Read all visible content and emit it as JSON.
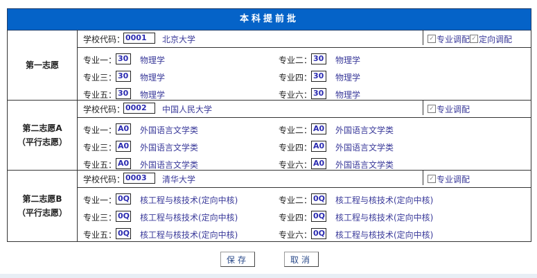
{
  "title": "本科提前批",
  "school_code_label": "学校代码：",
  "sections": [
    {
      "label": "第一志愿",
      "sublabel": "",
      "code": "0001",
      "school": "北京大学",
      "checks": [
        "专业调配",
        "定向调配"
      ],
      "majors": [
        {
          "label": "专业一：",
          "code": "30",
          "name": "物理学"
        },
        {
          "label": "专业二：",
          "code": "30",
          "name": "物理学"
        },
        {
          "label": "专业三：",
          "code": "30",
          "name": "物理学"
        },
        {
          "label": "专业四：",
          "code": "30",
          "name": "物理学"
        },
        {
          "label": "专业五：",
          "code": "30",
          "name": "物理学"
        },
        {
          "label": "专业六：",
          "code": "30",
          "name": "物理学"
        }
      ]
    },
    {
      "label": "第二志愿A",
      "sublabel": "（平行志愿）",
      "code": "0002",
      "school": "中国人民大学",
      "checks": [
        "专业调配"
      ],
      "majors": [
        {
          "label": "专业一：",
          "code": "A0",
          "name": "外国语言文学类"
        },
        {
          "label": "专业二：",
          "code": "A0",
          "name": "外国语言文学类"
        },
        {
          "label": "专业三：",
          "code": "A0",
          "name": "外国语言文学类"
        },
        {
          "label": "专业四：",
          "code": "A0",
          "name": "外国语言文学类"
        },
        {
          "label": "专业五：",
          "code": "A0",
          "name": "外国语言文学类"
        },
        {
          "label": "专业六：",
          "code": "A0",
          "name": "外国语言文学类"
        }
      ]
    },
    {
      "label": "第二志愿B",
      "sublabel": "（平行志愿）",
      "code": "0003",
      "school": "清华大学",
      "checks": [
        "专业调配"
      ],
      "majors": [
        {
          "label": "专业一：",
          "code": "0Q",
          "name": "核工程与核技术(定向中核)"
        },
        {
          "label": "专业二：",
          "code": "0Q",
          "name": "核工程与核技术(定向中核)"
        },
        {
          "label": "专业三：",
          "code": "0Q",
          "name": "核工程与核技术(定向中核)"
        },
        {
          "label": "专业四：",
          "code": "0Q",
          "name": "核工程与核技术(定向中核)"
        },
        {
          "label": "专业五：",
          "code": "0Q",
          "name": "核工程与核技术(定向中核)"
        },
        {
          "label": "专业六：",
          "code": "0Q",
          "name": "核工程与核技术(定向中核)"
        }
      ]
    }
  ],
  "buttons": {
    "save": "保存",
    "cancel": "取消"
  }
}
